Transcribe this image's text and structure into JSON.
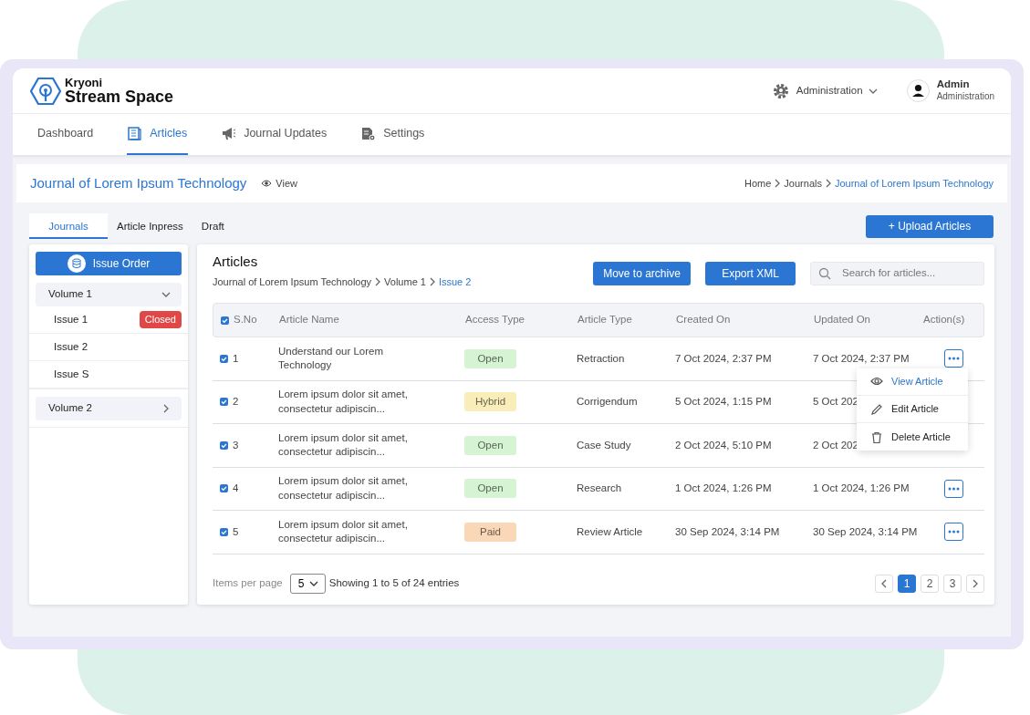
{
  "brand": {
    "line1": "Kryoni",
    "line2": "Stream Space"
  },
  "admin_menu": {
    "label": "Administration"
  },
  "user": {
    "name": "Admin",
    "role": "Administration"
  },
  "nav": [
    {
      "label": "Dashboard",
      "selected": false
    },
    {
      "label": "Articles",
      "selected": true
    },
    {
      "label": "Journal Updates",
      "selected": false
    },
    {
      "label": "Settings",
      "selected": false
    }
  ],
  "journal_bar": {
    "title": "Journal of Lorem Ipsum Technology",
    "view": "View",
    "breadcrumb": [
      {
        "label": "Home",
        "current": false
      },
      {
        "label": "Journals",
        "current": false
      },
      {
        "label": "Journal of Lorem Ipsum Technology",
        "current": true
      }
    ]
  },
  "sub_tabs": [
    {
      "label": "Journals",
      "selected": true
    },
    {
      "label": "Article Inpress",
      "selected": false
    },
    {
      "label": "Draft",
      "selected": false
    }
  ],
  "upload_button": "+ Upload Articles",
  "sidebar": {
    "issue_order": "Issue Order",
    "volumes": [
      {
        "label": "Volume 1",
        "expanded": true,
        "children": [
          {
            "label": "Issue 1",
            "badge": "Closed"
          },
          {
            "label": "Issue 2"
          },
          {
            "label": "Issue S"
          }
        ]
      },
      {
        "label": "Volume 2",
        "expanded": false
      }
    ]
  },
  "articles": {
    "title": "Articles",
    "breadcrumb": [
      {
        "label": "Journal of Lorem Ipsum Technology",
        "current": false
      },
      {
        "label": "Volume 1",
        "current": false
      },
      {
        "label": "Issue 2",
        "current": true
      }
    ],
    "buttons": [
      "Move to archive",
      "Export XML"
    ],
    "search": {
      "placeholder": "Search for articles..."
    },
    "all_checked": true,
    "columns": [
      "S.No",
      "Article Name",
      "Access Type",
      "Article Type",
      "Created On",
      "Updated On",
      "Action(s)"
    ],
    "rows": [
      {
        "checked": true,
        "sno": "1",
        "name": "Understand our Lorem Technology",
        "access": {
          "label": "Open",
          "color": "#d5f4d2"
        },
        "type": "Retraction",
        "created": "7 Oct 2024, 2:37 PM",
        "updated": "7 Oct 2024, 2:37 PM",
        "action_visible": true
      },
      {
        "checked": true,
        "sno": "2",
        "name": "Lorem ipsum dolor sit amet, consectetur adipiscin...",
        "access": {
          "label": "Hybrid",
          "color": "#f9eeb9"
        },
        "type": "Corrigendum",
        "created": "5 Oct 2024, 1:15 PM",
        "updated": "5 Oct 202",
        "action_visible": false
      },
      {
        "checked": true,
        "sno": "3",
        "name": "Lorem ipsum dolor sit amet, consectetur adipiscin...",
        "access": {
          "label": "Open",
          "color": "#d5f4d2"
        },
        "type": "Case Study",
        "created": "2 Oct 2024, 5:10 PM",
        "updated": "2 Oct 202",
        "action_visible": false
      },
      {
        "checked": true,
        "sno": "4",
        "name": "Lorem ipsum dolor sit amet, consectetur adipiscin...",
        "access": {
          "label": "Open",
          "color": "#d5f4d2"
        },
        "type": "Research",
        "created": "1 Oct 2024, 1:26 PM",
        "updated": "1 Oct 2024, 1:26 PM",
        "action_visible": true
      },
      {
        "checked": true,
        "sno": "5",
        "name": "Lorem ipsum dolor sit amet, consectetur adipiscin...",
        "access": {
          "label": "Paid",
          "color": "#f9d7b7"
        },
        "type": "Review Article",
        "created": "30 Sep 2024, 3:14 PM",
        "updated": "30 Sep 2024, 3:14 PM",
        "action_visible": true
      }
    ],
    "action_menu": {
      "items": [
        {
          "label": "View Article",
          "selected": true
        },
        {
          "label": "Edit Article",
          "selected": false
        },
        {
          "label": "Delete Article",
          "selected": false
        }
      ]
    },
    "items_per_page": "Items per page",
    "page_size": "5",
    "showing": "Showing 1 to 5 of 24 entries",
    "pages": [
      {
        "label": "1",
        "selected": true
      },
      {
        "label": "2",
        "selected": false
      },
      {
        "label": "3",
        "selected": false
      }
    ]
  }
}
